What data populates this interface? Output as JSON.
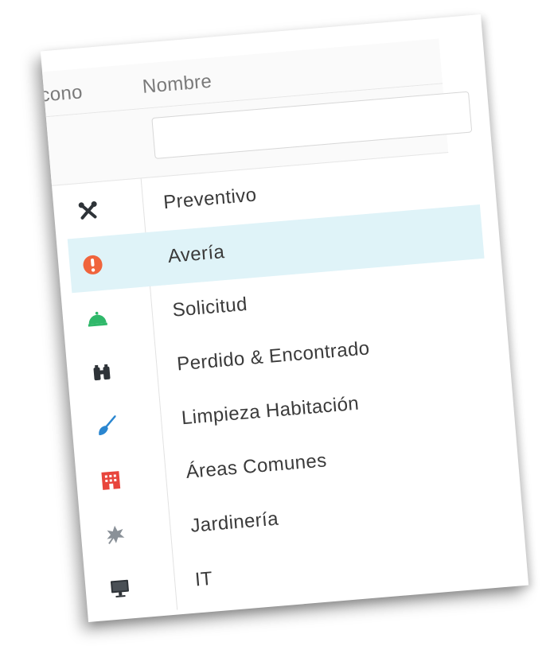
{
  "table": {
    "columns": {
      "icon_header": "Icono",
      "name_header": "Nombre"
    },
    "filter": {
      "value": "",
      "placeholder": ""
    },
    "rows": [
      {
        "label": "Preventivo",
        "icon": "tools-icon",
        "selected": false
      },
      {
        "label": "Avería",
        "icon": "alert-icon",
        "selected": true
      },
      {
        "label": "Solicitud",
        "icon": "service-bell-icon",
        "selected": false
      },
      {
        "label": "Perdido & Encontrado",
        "icon": "binoculars-icon",
        "selected": false
      },
      {
        "label": "Limpieza Habitación",
        "icon": "broom-icon",
        "selected": false
      },
      {
        "label": "Áreas Comunes",
        "icon": "building-icon",
        "selected": false
      },
      {
        "label": "Jardinería",
        "icon": "leaf-icon",
        "selected": false
      },
      {
        "label": "IT",
        "icon": "monitor-icon",
        "selected": false
      }
    ]
  },
  "colors": {
    "selected_row": "#dff3f8",
    "alert": "#f0643c",
    "bell": "#2fb86a",
    "broom": "#2a86d0",
    "building": "#e8453c",
    "leaf": "#8a9198",
    "text": "#3a3a3a",
    "header_text": "#7a7a7a"
  }
}
